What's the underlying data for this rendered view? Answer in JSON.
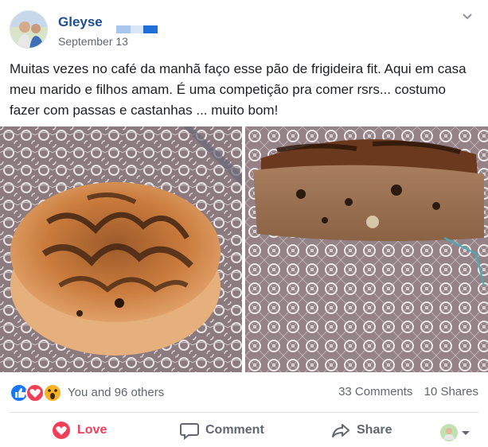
{
  "post": {
    "author": "Gleyse",
    "date": "September 13",
    "text": "Muitas vezes no café da manhã faço esse pão de frigideira fit. Aqui em casa meu marido e filhos amam. É uma competição pra comer rsrs... costumo fazer com passas e castanhas ... muito bom!"
  },
  "icons": {
    "options": "chevron-down-icon",
    "like": "like-icon",
    "love": "heart-icon",
    "wow": "wow-icon",
    "comment": "comment-icon",
    "share": "share-icon"
  },
  "reactions": {
    "summary": "You and 96 others",
    "comments": "33 Comments",
    "shares": "10 Shares"
  },
  "actions": {
    "love": "Love",
    "comment": "Comment",
    "share": "Share"
  },
  "colors": {
    "author": "#1d4f91",
    "love_active": "#f33e58",
    "like_blue": "#1877f2",
    "muted": "#606770"
  }
}
